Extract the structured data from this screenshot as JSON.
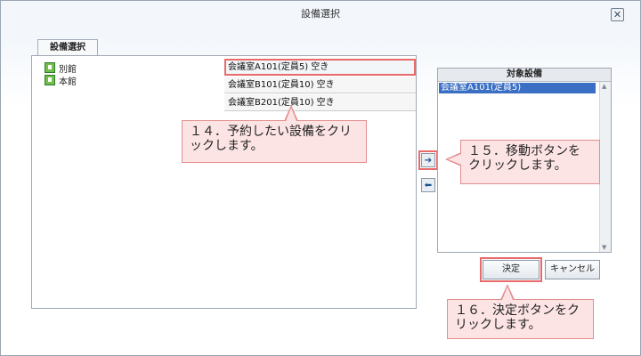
{
  "dialog": {
    "title": "設備選択",
    "close_glyph": "✕"
  },
  "tab": {
    "label": "設備選択"
  },
  "buildings": [
    {
      "label": "別館"
    },
    {
      "label": "本館"
    }
  ],
  "rooms": [
    {
      "label": "会議室A101(定員5) 空き"
    },
    {
      "label": "会議室B101(定員10) 空き"
    },
    {
      "label": "会議室B201(定員10) 空き"
    }
  ],
  "move_buttons": {
    "right_glyph": "➔",
    "left_glyph": "⬅"
  },
  "target_panel": {
    "header": "対象設備",
    "items": [
      {
        "label": "会議室A101(定員5)"
      }
    ]
  },
  "buttons": {
    "decide": "決定",
    "cancel": "キャンセル"
  },
  "callouts": {
    "c14": "１４．予約したい設備をクリックします。",
    "c15": "１５．移動ボタンをクリックします。",
    "c16": "１６．決定ボタンをクリックします。"
  },
  "colors": {
    "callout_bg": "#fde4e4",
    "callout_border": "#e38d8d",
    "selection_blue": "#3a6fc4",
    "highlight_red": "#e86a6a"
  }
}
